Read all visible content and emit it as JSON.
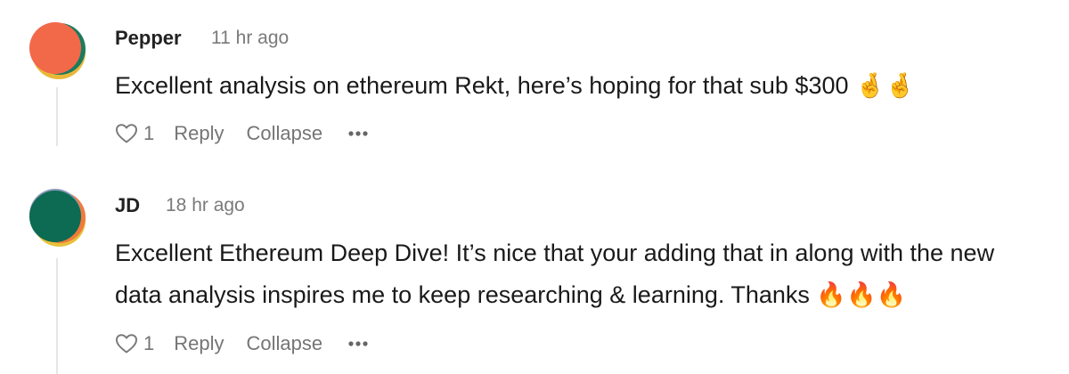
{
  "comments": [
    {
      "author": "Pepper",
      "time": "11 hr ago",
      "body_lines": [
        "Excellent analysis on ethereum Rekt, here’s hoping for that sub $300 🤞🤞"
      ],
      "likes": "1",
      "reply_label": "Reply",
      "collapse_label": "Collapse",
      "avatar_colors": [
        "#f2694a",
        "#e9b83a",
        "#1d7a5e"
      ]
    },
    {
      "author": "JD",
      "time": "18 hr ago",
      "body_lines": [
        "Excellent Ethereum Deep Dive! It’s nice that your adding that in along with the new",
        "data analysis inspires me to keep researching & learning. Thanks 🔥🔥🔥"
      ],
      "likes": "1",
      "reply_label": "Reply",
      "collapse_label": "Collapse",
      "avatar_colors": [
        "#0c6b52",
        "#f07a3c",
        "#e7c13a",
        "#8a9ab8"
      ]
    }
  ],
  "icons": {
    "like": "heart-icon",
    "more": "ellipsis-icon"
  }
}
